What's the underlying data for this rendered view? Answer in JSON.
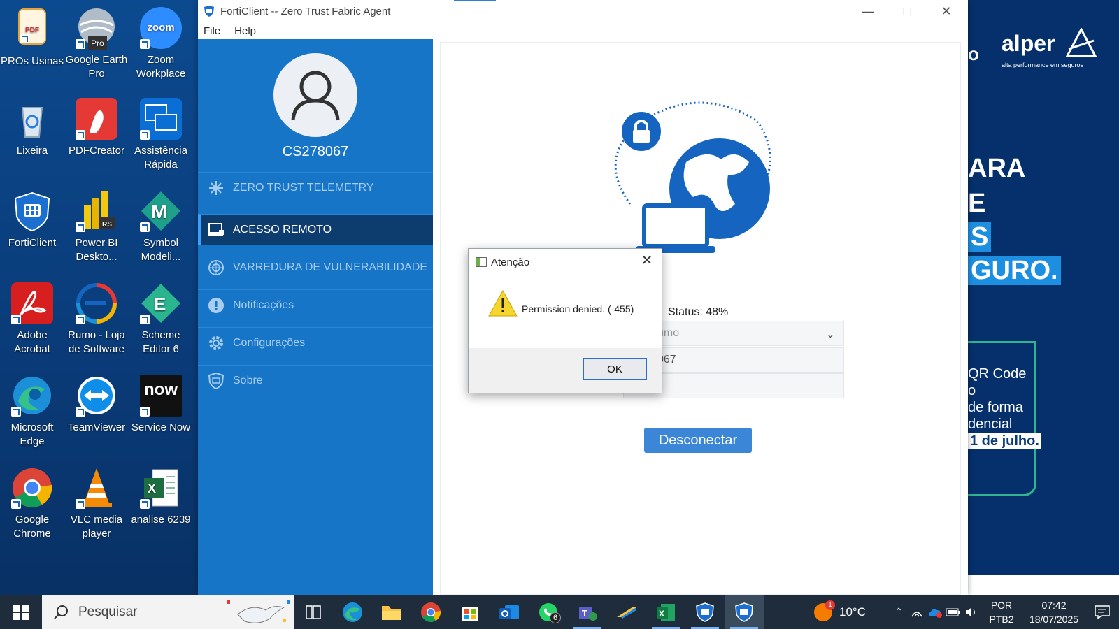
{
  "desktop": {
    "icons": [
      {
        "label": "PROs Usinas",
        "icon": "pdf-document-icon"
      },
      {
        "label": "Google Earth Pro",
        "icon": "google-earth-icon"
      },
      {
        "label": "Zoom Workplace",
        "icon": "zoom-icon",
        "badge": "zoom"
      },
      {
        "label": "Lixeira",
        "icon": "recycle-bin-icon"
      },
      {
        "label": "PDFCreator",
        "icon": "pdfcreator-icon"
      },
      {
        "label": "Assistência Rápida",
        "icon": "quick-assist-icon"
      },
      {
        "label": "FortiClient",
        "icon": "forticlient-icon"
      },
      {
        "label": "Power BI Deskto...",
        "icon": "power-bi-icon",
        "badge": "RS"
      },
      {
        "label": "Symbol Modeli...",
        "icon": "symbol-modeler-icon"
      },
      {
        "label": "Adobe Acrobat",
        "icon": "adobe-acrobat-icon"
      },
      {
        "label": "Rumo - Loja de Software",
        "icon": "rumo-store-icon"
      },
      {
        "label": "Scheme Editor 6",
        "icon": "scheme-editor-icon"
      },
      {
        "label": "Microsoft Edge",
        "icon": "edge-icon"
      },
      {
        "label": "TeamViewer",
        "icon": "teamviewer-icon"
      },
      {
        "label": "Service Now",
        "icon": "servicenow-icon",
        "badge": "now"
      },
      {
        "label": "Google Chrome",
        "icon": "chrome-icon"
      },
      {
        "label": "VLC media player",
        "icon": "vlc-icon"
      },
      {
        "label": "analise 6239",
        "icon": "excel-file-icon"
      }
    ],
    "pro_badge": "Pro"
  },
  "wallpaper": {
    "brand": "alper",
    "tagline": "alta performance em seguros",
    "lines": [
      "ARA",
      "E",
      "S",
      "GURO."
    ],
    "promo_lines": [
      "QR Code",
      "o",
      "de forma",
      "dencial",
      "1 de julho."
    ],
    "partial_o": "o"
  },
  "window": {
    "title": "FortiClient -- Zero Trust Fabric Agent",
    "menu": [
      "File",
      "Help"
    ],
    "user": "CS278067",
    "nav": [
      {
        "label": "ZERO TRUST TELEMETRY",
        "icon": "telemetry-icon"
      },
      {
        "label": "ACESSO REMOTO",
        "icon": "laptop-lock-icon",
        "active": true
      },
      {
        "label": "VARREDURA DE VULNERABILIDADE",
        "icon": "radar-icon"
      },
      {
        "label": "Notificações",
        "icon": "alert-circle-icon"
      },
      {
        "label": "Configurações",
        "icon": "gear-icon"
      },
      {
        "label": "Sobre",
        "icon": "shield-icon"
      }
    ],
    "status": "Status: 48%",
    "status_progress": 48,
    "field_vpn": "umo",
    "field_user": "067",
    "field_password": "",
    "disconnect": "Desconectar"
  },
  "dialog": {
    "title": "Atenção",
    "message": "Permission denied. (-455)",
    "ok": "OK"
  },
  "taskbar": {
    "search_placeholder": "Pesquisar",
    "whatsapp_badge": "6",
    "weather_badge": "1",
    "temperature": "10°C",
    "lang": "POR",
    "layout": "PTB2",
    "time": "07:42",
    "date": "18/07/2025"
  }
}
